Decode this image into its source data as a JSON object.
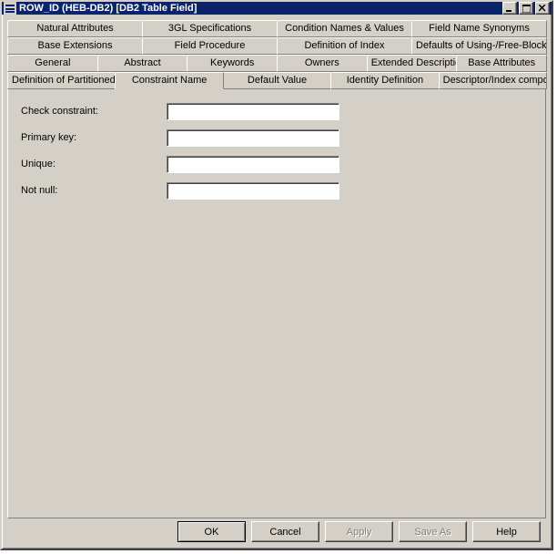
{
  "window": {
    "title": "ROW_ID (HEB-DB2) [DB2 Table Field]"
  },
  "tabs": {
    "row1": [
      "Natural Attributes",
      "3GL Specifications",
      "Condition Names & Values",
      "Field Name Synonyms"
    ],
    "row2": [
      "Base Extensions",
      "Field Procedure",
      "Definition of Index",
      "Defaults of Using-/Free-Block"
    ],
    "row3": [
      "General",
      "Abstract",
      "Keywords",
      "Owners",
      "Extended Description",
      "Base Attributes"
    ],
    "row4": [
      "Definition of Partitioned Index",
      "Constraint Name",
      "Default Value",
      "Identity Definition",
      "Descriptor/Index composition"
    ],
    "activeIndexRow4": 1
  },
  "form": {
    "check_constraint_label": "Check constraint:",
    "check_constraint_value": "",
    "primary_key_label": "Primary key:",
    "primary_key_value": "",
    "unique_label": "Unique:",
    "unique_value": "",
    "not_null_label": "Not null:",
    "not_null_value": ""
  },
  "buttons": {
    "ok": "OK",
    "cancel": "Cancel",
    "apply": "Apply",
    "save_as": "Save As",
    "help": "Help"
  }
}
